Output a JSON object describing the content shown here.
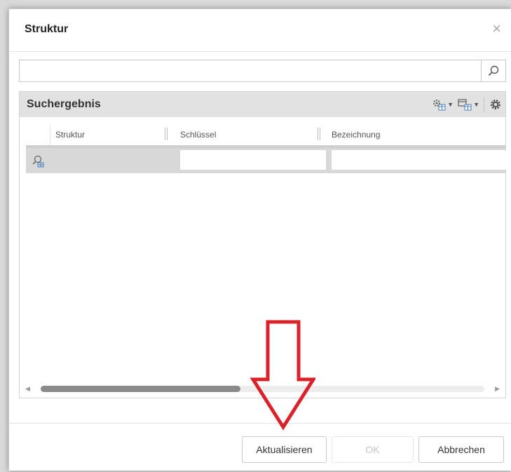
{
  "dialog": {
    "title": "Struktur",
    "close_glyph": "×"
  },
  "search": {
    "value": "",
    "placeholder": "",
    "icon": "magnifier-icon"
  },
  "result_panel": {
    "title": "Suchergebnis",
    "tools": [
      "settings-grid-icon",
      "columns-grid-icon",
      "gear-icon"
    ],
    "columns": [
      "Struktur",
      "Schlüssel",
      "Bezeichnung"
    ],
    "rows": [
      {
        "row_icon": "search-structure-icon",
        "struktur": "",
        "schluessel": "",
        "bezeichnung": ""
      }
    ],
    "scroll_position": 0.45
  },
  "footer": {
    "refresh_label": "Aktualisieren",
    "ok_label": "OK",
    "cancel_label": "Abbrechen"
  },
  "colors": {
    "annotation_arrow": "#d9222a",
    "panel_header": "#e2e2e2",
    "selected_row": "#d8d8d8"
  }
}
